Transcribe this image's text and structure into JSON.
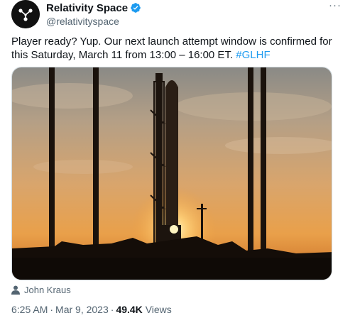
{
  "author": {
    "display_name": "Relativity Space",
    "handle": "@relativityspace",
    "verified": true,
    "avatar_icon": "relativity-logo-icon"
  },
  "more_icon": "more-options-icon",
  "tweet": {
    "text_before": "Player ready? Yup. Our next launch attempt window is confirmed for this Saturday, March 11 from 13:00 – 16:00 ET. ",
    "hashtag": "#GLHF"
  },
  "media": {
    "description_icon": "rocket-launch-pad-photo",
    "credit": "John Kraus",
    "credit_icon": "person-icon"
  },
  "meta": {
    "time": "6:25 AM",
    "date": "Mar 9, 2023",
    "separator": "·",
    "views_count": "49.4K",
    "views_label": "Views"
  },
  "colors": {
    "accent": "#1d9bf0",
    "text_primary": "#0f1419",
    "text_secondary": "#536471"
  }
}
